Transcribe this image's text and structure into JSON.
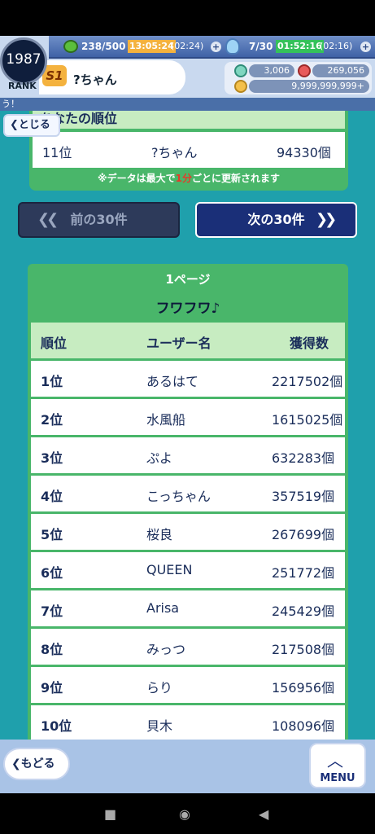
{
  "hud": {
    "rank_number": "1987",
    "rank_label": "RANK",
    "stamina": "238/500",
    "stamina_timer": "13:05:24",
    "stamina_timer_sub": "(02:24)",
    "potion": "7/30",
    "potion_timer": "01:52:16",
    "potion_timer_sub": "(02:16)",
    "rank_tag": "S1",
    "player_name": "?ちゃん",
    "currency_gem": "3,006",
    "currency_heart": "269,056",
    "currency_coin": "9,999,999,999+",
    "plus": "+"
  },
  "ticker": "う！",
  "close_button": "とじる",
  "my_rank": {
    "heading": "あなたの順位",
    "rank": "11位",
    "name": "?ちゃん",
    "score": "94330個",
    "note_before": "※データは最大で",
    "note_red": "1分",
    "note_after": "ごとに更新されます"
  },
  "pager": {
    "prev": "前の30件",
    "next": "次の30件"
  },
  "ranking": {
    "page_label": "1ページ",
    "event_title": "フワフワ♪",
    "headers": {
      "rank": "順位",
      "name": "ユーザー名",
      "score": "獲得数"
    },
    "rows": [
      {
        "rank": "1位",
        "name": "あるはて",
        "score": "2217502個"
      },
      {
        "rank": "2位",
        "name": "水風船",
        "score": "1615025個"
      },
      {
        "rank": "3位",
        "name": "ぷよ",
        "score": "632283個"
      },
      {
        "rank": "4位",
        "name": "こっちゃん",
        "score": "357519個"
      },
      {
        "rank": "5位",
        "name": "桜良",
        "score": "267699個"
      },
      {
        "rank": "6位",
        "name": "QUEEN",
        "score": "251772個"
      },
      {
        "rank": "7位",
        "name": "Arisa",
        "score": "245429個"
      },
      {
        "rank": "8位",
        "name": "みっつ",
        "score": "217508個"
      },
      {
        "rank": "9位",
        "name": "らり",
        "score": "156956個"
      },
      {
        "rank": "10位",
        "name": "貝木",
        "score": "108096個"
      }
    ]
  },
  "bottom": {
    "back": "もどる",
    "menu": "MENU"
  },
  "colors": {
    "background": "#1fa0ac",
    "card_green": "#49b66a",
    "header_green": "#c7ecc1",
    "navy": "#1a2f78"
  }
}
